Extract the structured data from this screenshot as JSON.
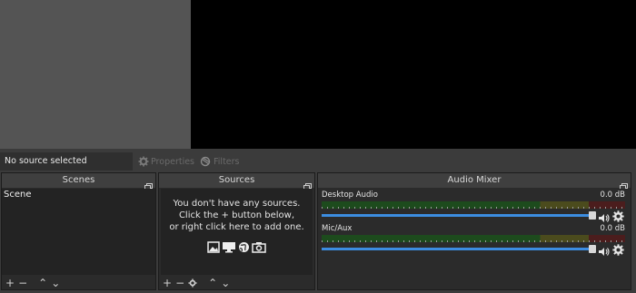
{
  "source_toolbar": {
    "no_source": "No source selected",
    "properties_label": "Properties",
    "filters_label": "Filters"
  },
  "scenes": {
    "title": "Scenes",
    "items": [
      "Scene"
    ]
  },
  "sources": {
    "title": "Sources",
    "empty_line1": "You don't have any sources.",
    "empty_line2": "Click the + button below,",
    "empty_line3": "or right click here to add one."
  },
  "mixer": {
    "title": "Audio Mixer",
    "channels": [
      {
        "name": "Desktop Audio",
        "level": "0.0 dB",
        "volume": 1.0
      },
      {
        "name": "Mic/Aux",
        "level": "0.0 dB",
        "volume": 1.0
      }
    ]
  },
  "colors": {
    "accent": "#3c8de0",
    "panel": "#2b2b2b",
    "preview": "#000000"
  },
  "icons": {
    "add": "plus-icon",
    "remove": "minus-icon",
    "up": "chevron-up-icon",
    "down": "chevron-down-icon",
    "settings": "gear-icon",
    "undock": "undock-icon",
    "speaker": "speaker-icon",
    "image": "image-icon",
    "display": "display-icon",
    "globe": "globe-icon",
    "camera": "camera-icon"
  }
}
